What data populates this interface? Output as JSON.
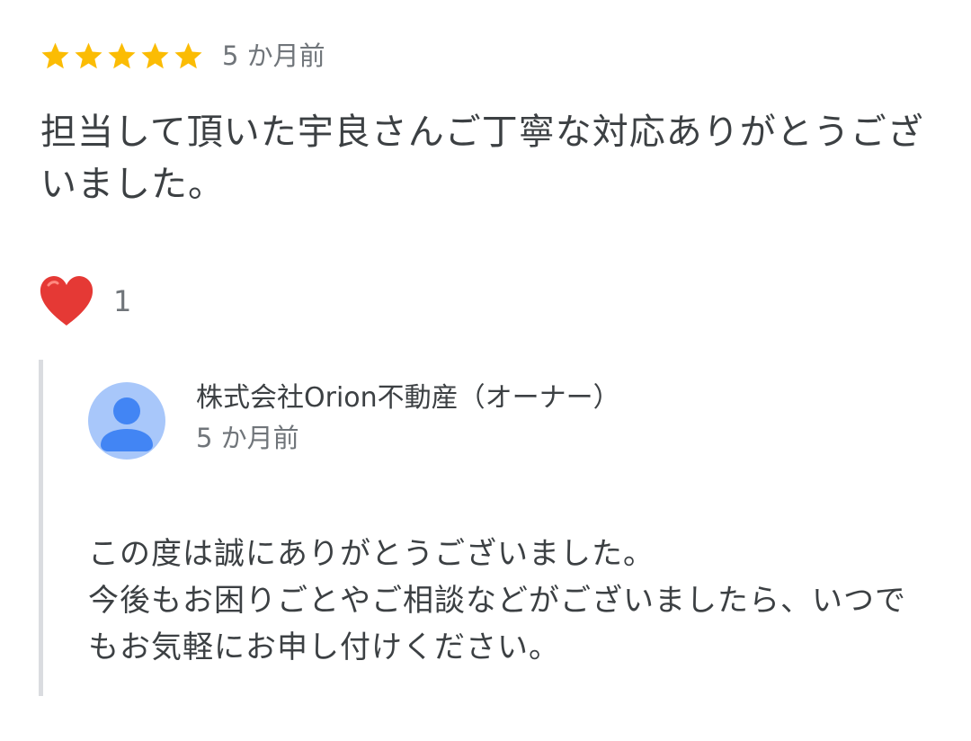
{
  "review": {
    "rating": 5,
    "rating_max": 5,
    "date": "5 か月前",
    "text": "担当して頂いた宇良さんご丁寧な対応ありがとうございました。",
    "reaction": {
      "icon": "heart-icon",
      "color": "#e53935",
      "count": "1"
    }
  },
  "owner_reply": {
    "name": "株式会社Orion不動産（オーナー）",
    "date": "5 か月前",
    "text": "この度は誠にありがとうございました。\n今後もお困りごとやご相談などがございましたら、いつでもお気軽にお申し付けください。",
    "avatar_color": "#a8c7fa",
    "avatar_figure_color": "#4285f4"
  },
  "colors": {
    "star": "#fbbc04",
    "border": "#dadce0",
    "secondary_text": "#70757a",
    "primary_text": "#3c4043"
  }
}
